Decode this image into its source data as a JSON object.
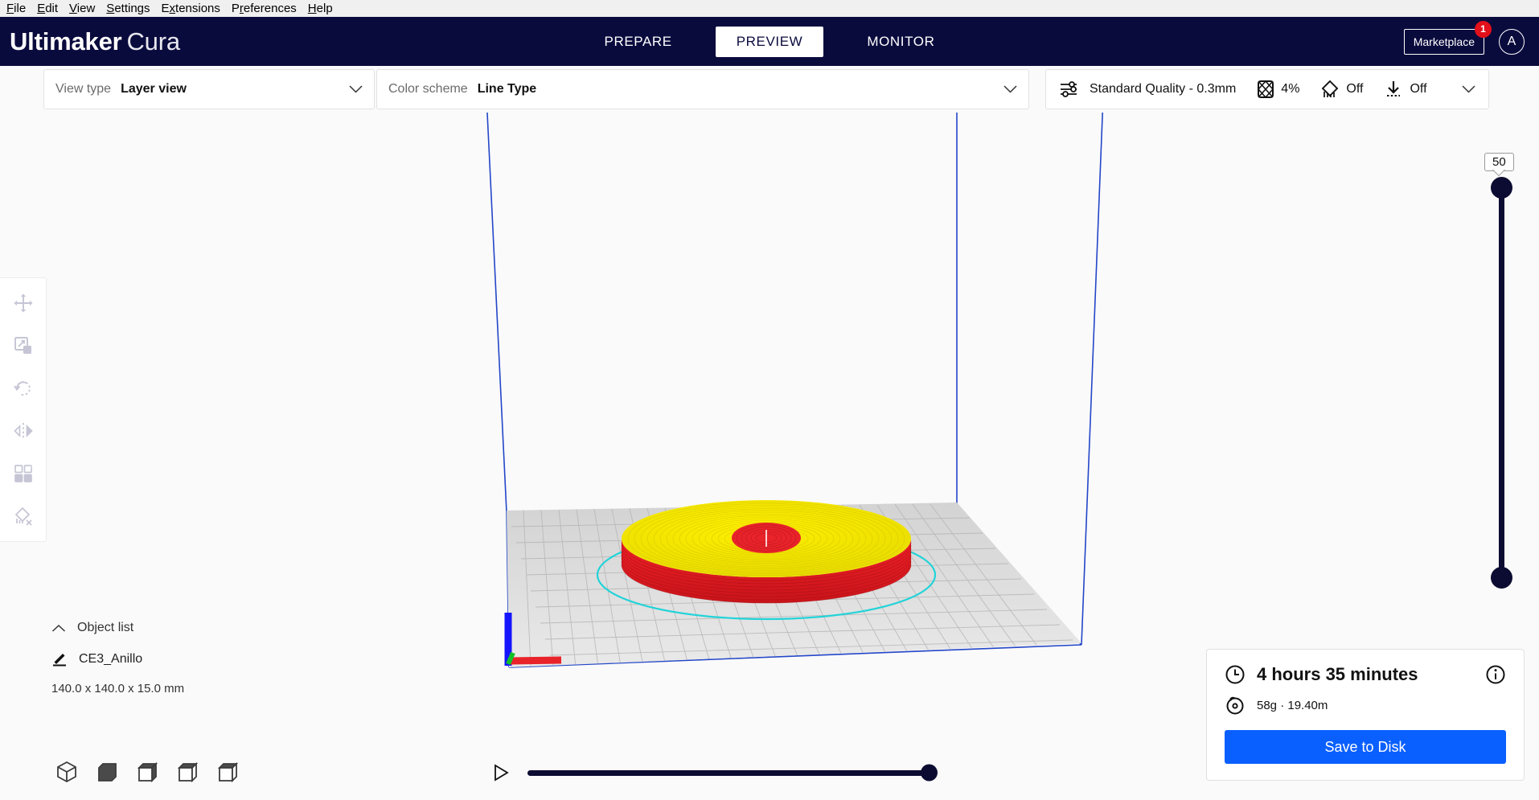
{
  "menubar": {
    "items": [
      {
        "mnemonic": "F",
        "rest": "ile"
      },
      {
        "mnemonic": "E",
        "rest": "dit"
      },
      {
        "mnemonic": "V",
        "rest": "iew"
      },
      {
        "mnemonic": "S",
        "rest": "ettings"
      },
      {
        "mnemonic": "E",
        "rest": "xtensions",
        "pre": ""
      },
      {
        "mnemonic": "P",
        "rest": "references"
      },
      {
        "mnemonic": "H",
        "rest": "elp"
      }
    ],
    "labels": [
      "File",
      "Edit",
      "View",
      "Settings",
      "Extensions",
      "Preferences",
      "Help"
    ]
  },
  "header": {
    "brand_bold": "Ultimaker",
    "brand_light": "Cura",
    "tabs": [
      {
        "label": "PREPARE",
        "active": false
      },
      {
        "label": "PREVIEW",
        "active": true
      },
      {
        "label": "MONITOR",
        "active": false
      }
    ],
    "marketplace_label": "Marketplace",
    "marketplace_badge": "1",
    "avatar_initial": "A",
    "bg_color": "#0a0b3d"
  },
  "toolbar": {
    "view_type_label": "View type",
    "view_type_value": "Layer view",
    "color_scheme_label": "Color scheme",
    "color_scheme_value": "Line Type",
    "profile_value": "Standard Quality - 0.3mm",
    "infill_value": "4%",
    "support_value": "Off",
    "adhesion_value": "Off"
  },
  "left_tools": [
    {
      "name": "move-tool",
      "title": "Move"
    },
    {
      "name": "scale-tool",
      "title": "Scale"
    },
    {
      "name": "rotate-tool",
      "title": "Rotate"
    },
    {
      "name": "mirror-tool",
      "title": "Mirror"
    },
    {
      "name": "per-model-settings-tool",
      "title": "Per Model Settings"
    },
    {
      "name": "support-blocker-tool",
      "title": "Support Blocker"
    }
  ],
  "object_list": {
    "title": "Object list",
    "item_name": "CE3_Anillo",
    "dimensions": "140.0 x 140.0 x 15.0 mm"
  },
  "view_cubes": [
    "3d-view",
    "front-view",
    "top-view",
    "left-view",
    "right-view"
  ],
  "layer_slider": {
    "value": "50",
    "min": "0",
    "max": "50"
  },
  "playback": {
    "play_label": "Play",
    "position_percent": 100
  },
  "print_info": {
    "time": "4 hours 35 minutes",
    "material": "58g · 19.40m",
    "save_label": "Save to Disk",
    "accent_color": "#0a60ff"
  },
  "scene": {
    "model_top_color": "#f2e500",
    "model_wall_color": "#e8232a",
    "outline_color": "#22d3d8",
    "buildvolume_color": "#2346c8",
    "plate_color": "#e2e2e2"
  }
}
